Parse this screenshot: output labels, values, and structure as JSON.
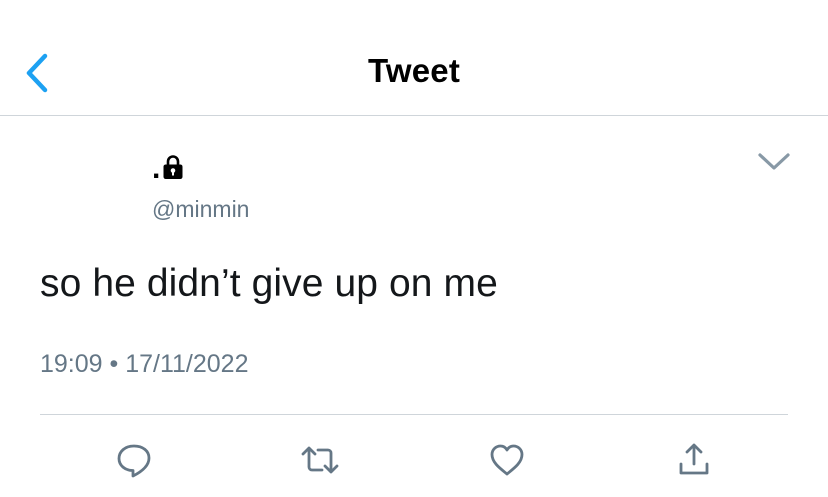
{
  "header": {
    "title": "Tweet",
    "back_icon": "chevron-left-icon"
  },
  "author": {
    "display_name": ".",
    "protected_icon": "lock-icon",
    "handle": "@minmin"
  },
  "tweet": {
    "text": "so he didn’t give up on me",
    "timestamp": "19:09 • 17/11/2022",
    "menu_icon": "chevron-down-icon"
  },
  "actions": [
    {
      "name": "reply",
      "icon": "reply-icon"
    },
    {
      "name": "retweet",
      "icon": "retweet-icon"
    },
    {
      "name": "like",
      "icon": "heart-icon"
    },
    {
      "name": "share",
      "icon": "share-icon"
    }
  ],
  "colors": {
    "accent": "#1da1f2",
    "secondary_text": "#657786",
    "action_icon": "#657786",
    "divider": "#cfd5da"
  }
}
